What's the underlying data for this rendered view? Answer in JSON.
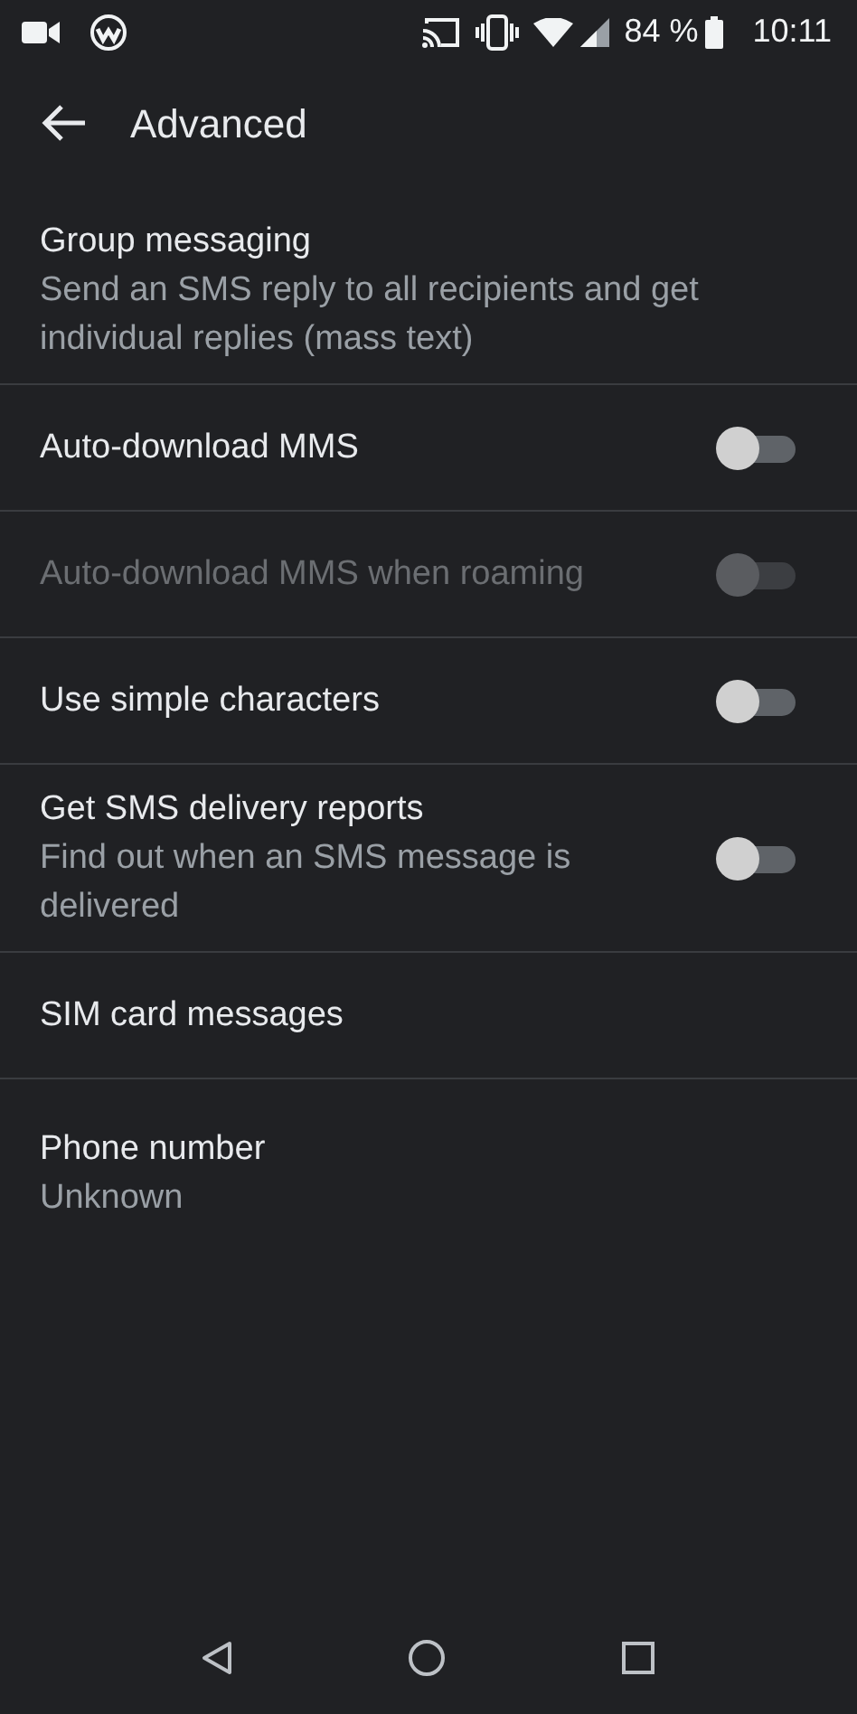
{
  "status_bar": {
    "battery": "84 %",
    "time": "10:11"
  },
  "toolbar": {
    "title": "Advanced"
  },
  "settings": [
    {
      "kind": "plain",
      "title": "Group messaging",
      "summary": "Send an SMS reply to all recipients and get individual replies (mass text)",
      "disabled": false
    },
    {
      "kind": "toggle",
      "title": "Auto-download MMS",
      "on": false,
      "disabled": false
    },
    {
      "kind": "toggle",
      "title": "Auto-download MMS when roaming",
      "on": false,
      "disabled": true
    },
    {
      "kind": "toggle",
      "title": "Use simple characters",
      "on": false,
      "disabled": false
    },
    {
      "kind": "toggle",
      "title": "Get SMS delivery reports",
      "summary": "Find out when an SMS message is delivered",
      "on": false,
      "disabled": false
    },
    {
      "kind": "plain",
      "title": "SIM card messages",
      "disabled": false
    },
    {
      "kind": "plain",
      "title": "Phone number",
      "summary": "Unknown",
      "disabled": false
    }
  ]
}
